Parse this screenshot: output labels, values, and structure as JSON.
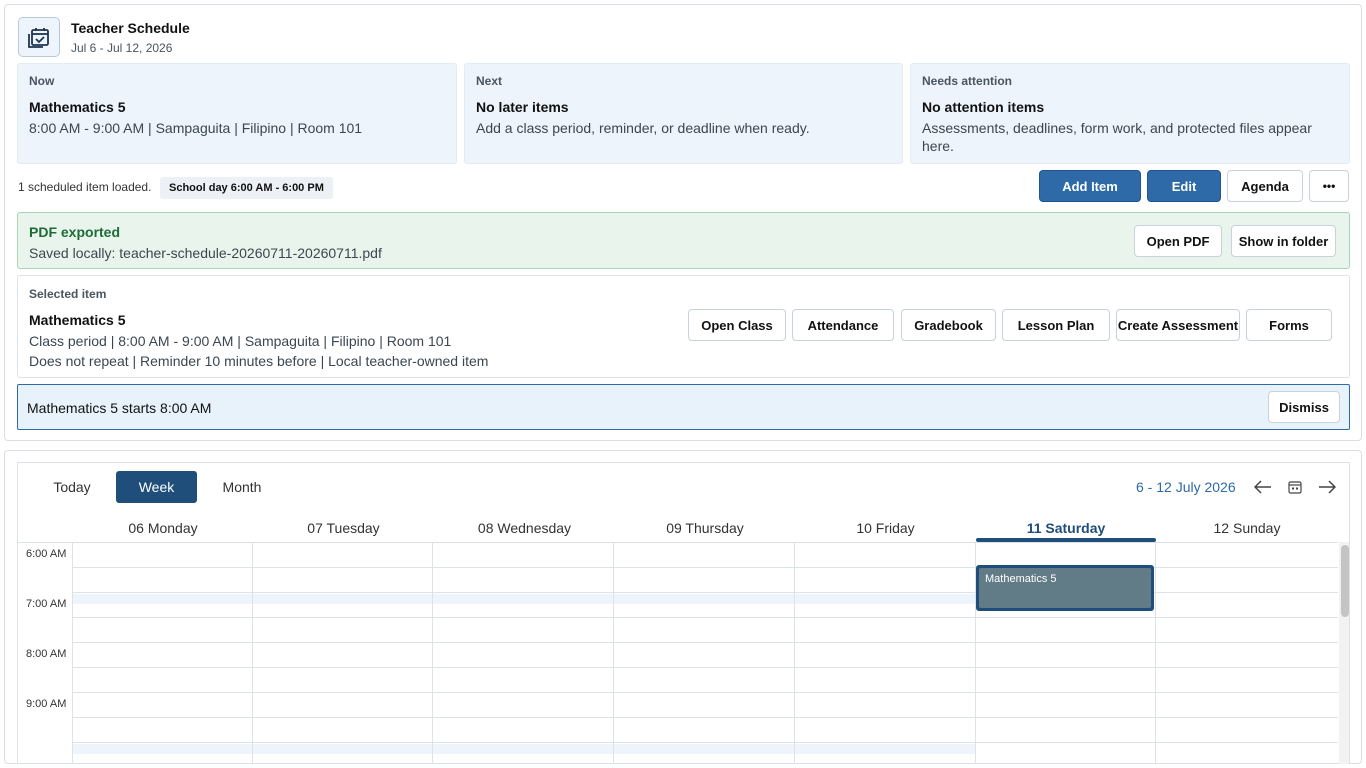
{
  "header": {
    "title": "Teacher Schedule",
    "subtitle": "Jul 6 - Jul 12, 2026",
    "icon": "calendar-check-icon"
  },
  "cards": [
    {
      "label": "Now",
      "title": "Mathematics 5",
      "text": "8:00 AM - 9:00 AM | Sampaguita | Filipino | Room 101"
    },
    {
      "label": "Next",
      "title": "No later items",
      "text": "Add a class period, reminder, or deadline when ready."
    },
    {
      "label": "Needs attention",
      "title": "No attention items",
      "text": "Assessments, deadlines, form work, and protected files appear here."
    }
  ],
  "status": {
    "loaded": "1 scheduled item loaded.",
    "school_day": "School day 6:00 AM - 6:00 PM"
  },
  "toolbar": {
    "add_item": "Add Item",
    "edit": "Edit",
    "agenda": "Agenda",
    "more": "•••"
  },
  "export": {
    "title": "PDF exported",
    "saved": "Saved locally: teacher-schedule-20260711-20260711.pdf",
    "open_pdf": "Open PDF",
    "show_folder": "Show in folder"
  },
  "selected": {
    "label": "Selected item",
    "title": "Mathematics 5",
    "line1": "Class period | 8:00 AM - 9:00 AM | Sampaguita | Filipino | Room 101",
    "line2": "Does not repeat | Reminder 10 minutes before | Local teacher-owned item",
    "actions": [
      "Open Class",
      "Attendance",
      "Gradebook",
      "Lesson Plan",
      "Create Assessment",
      "Forms"
    ]
  },
  "reminder": {
    "text": "Mathematics 5 starts 8:00 AM",
    "dismiss": "Dismiss"
  },
  "calendar": {
    "views": [
      "Today",
      "Week",
      "Month"
    ],
    "active_view": "Week",
    "range": "6  - 12 July 2026",
    "days": [
      "06 Monday",
      "07 Tuesday",
      "08 Wednesday",
      "09 Thursday",
      "10 Friday",
      "11 Saturday",
      "12 Sunday"
    ],
    "current_day": "11 Saturday",
    "times": [
      "6:00 AM",
      "7:00 AM",
      "8:00 AM",
      "9:00 AM"
    ],
    "event": {
      "title": "Mathematics 5",
      "day": "11 Saturday",
      "start": "8:00 AM",
      "end": "9:00 AM"
    },
    "accent": "#1f4e7a"
  }
}
